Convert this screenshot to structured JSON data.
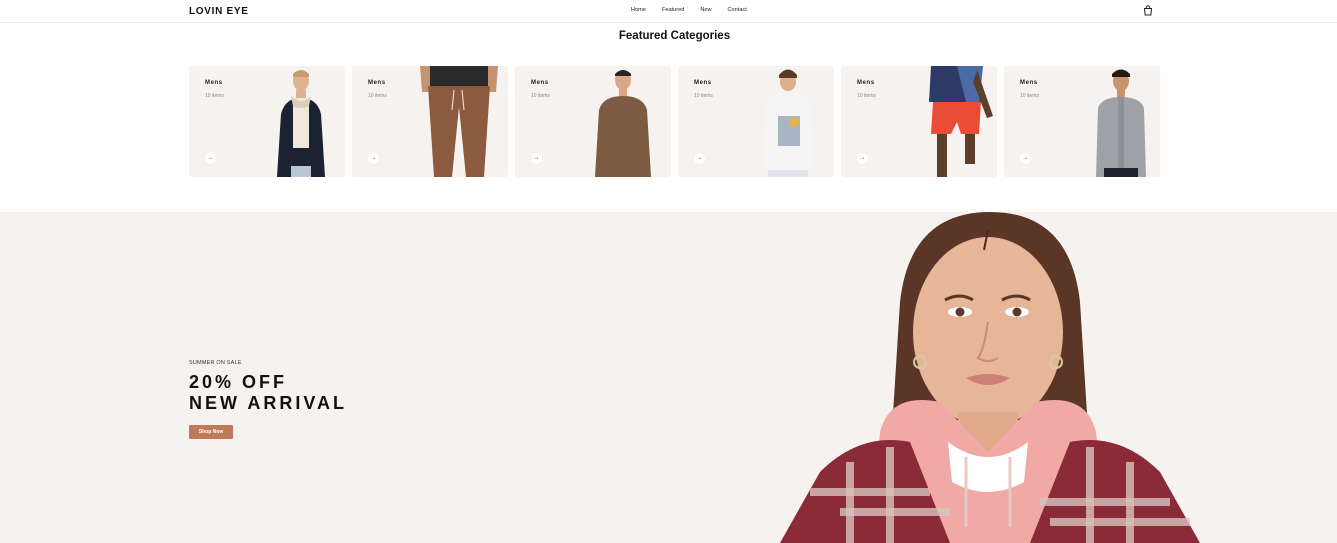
{
  "header": {
    "logo": "LOVIN EYE",
    "nav": [
      "Home",
      "Featured",
      "New",
      "Contact"
    ],
    "cart_icon": "bag-icon"
  },
  "featured": {
    "title": "Featured Categories",
    "cards": [
      {
        "title": "Mens",
        "count": "10 items",
        "figure": "man-jacket"
      },
      {
        "title": "Mens",
        "count": "10 items",
        "figure": "pants"
      },
      {
        "title": "Mens",
        "count": "10 items",
        "figure": "man-sweater"
      },
      {
        "title": "Mens",
        "count": "10 items",
        "figure": "man-tshirt"
      },
      {
        "title": "Mens",
        "count": "10 items",
        "figure": "man-shorts"
      },
      {
        "title": "Mens",
        "count": "10 items",
        "figure": "man-shirt"
      }
    ],
    "arrow": "→"
  },
  "hero": {
    "kicker": "SUMMER ON SALE",
    "line1": "20% OFF",
    "line2": "NEW ARRIVAL",
    "button": "Shop Now"
  },
  "colors": {
    "card_bg": "#f6f2ef",
    "accent": "#c07a5a"
  }
}
